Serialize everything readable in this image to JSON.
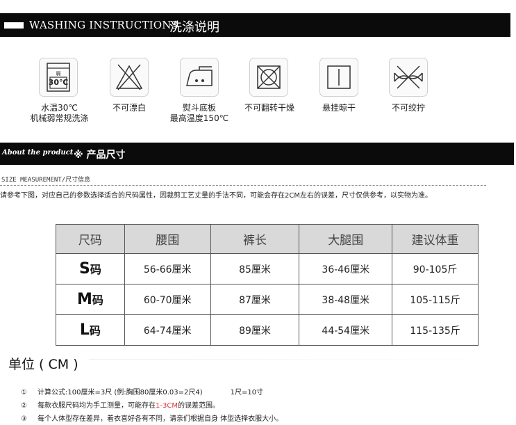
{
  "washing": {
    "title_en": "WASHING INSTRUCTIONS",
    "title_zh": "洗涤说明",
    "icons": [
      {
        "icon": "wash-30-icon",
        "symbol_text": "30℃",
        "symbol_small": "弱",
        "caption_l1": "水温30℃",
        "caption_l2": "机械弱常规洗涤"
      },
      {
        "icon": "no-bleach-icon",
        "caption_l1": "不可漂白"
      },
      {
        "icon": "iron-150-icon",
        "caption_l1": "熨斗底板",
        "caption_l2": "最高温度150℃"
      },
      {
        "icon": "no-tumble-dry-icon",
        "caption_l1": "不可翻转干燥"
      },
      {
        "icon": "hang-dry-icon",
        "caption_l1": "悬挂晾干"
      },
      {
        "icon": "no-wring-icon",
        "caption_l1": "不可绞拧"
      }
    ]
  },
  "about": {
    "title_en": "About the product",
    "title_zh": "※ 产品尺寸"
  },
  "size_measurement": {
    "heading": "SIZE MEASUREMENT/尺寸信息",
    "note": "请参考下图，对应自己的参数选择适合的尺码属性，因裁剪工艺丈量的手法不同，可能会存在2CM左右的误差，尺寸仅供参考，以实物为准。"
  },
  "table": {
    "headers": [
      "尺码",
      "腰围",
      "裤长",
      "大腿围",
      "建议体重"
    ],
    "rows": [
      {
        "size": "S",
        "unit": "码",
        "waist": "56-66厘米",
        "length": "85厘米",
        "thigh": "36-46厘米",
        "weight": "90-105斤"
      },
      {
        "size": "M",
        "unit": "码",
        "waist": "60-70厘米",
        "length": "87厘米",
        "thigh": "38-48厘米",
        "weight": "105-115斤"
      },
      {
        "size": "L",
        "unit": "码",
        "waist": "64-74厘米",
        "length": "89厘米",
        "thigh": "44-54厘米",
        "weight": "115-135斤"
      }
    ]
  },
  "unit_label": "单位 ( CM )",
  "footnotes": {
    "n1": "①",
    "t1": "计算公式:100厘米=3尺 (例:胸围80厘米0.03=2尺4)",
    "t1b": "1尺=10寸",
    "n2": "②",
    "t2a": "每款衣服尺码均为手工测量，可能存在",
    "t2red": "1-3CM",
    "t2b": "的误差范围。",
    "n3": "③",
    "t3": "每个人体型存在差异，着衣喜好各有不同，请亲们根据自身 体型选择衣服大小。",
    "highlight_color": "#e03030"
  }
}
